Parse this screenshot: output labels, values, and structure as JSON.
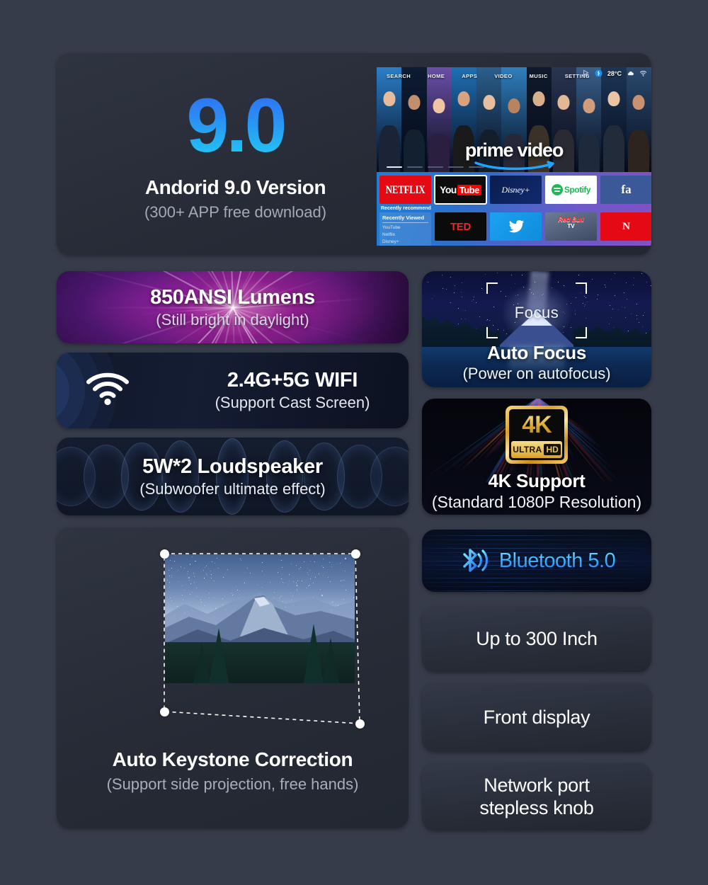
{
  "theme": {
    "page_bg": "#373c4a",
    "card_bg": "#2b303c",
    "accent_cyan": "#1fd2f5",
    "accent_blue": "#2d6bf5",
    "gold": "#d9a32c"
  },
  "android": {
    "version_number": "9.0",
    "title": "Andorid 9.0 Version",
    "subtitle": "(300+ APP free download)",
    "tv": {
      "nav_items": [
        "SEARCH",
        "HOME",
        "APPS",
        "VIDEO",
        "MUSIC",
        "SETTING"
      ],
      "status": {
        "cursor_icon": "cursor-icon",
        "bluetooth_icon": "bluetooth-icon",
        "temperature": "28°C",
        "weather_icon": "cloud-icon",
        "wifi_icon": "wifi-icon"
      },
      "brand": "prime video",
      "apps_row1": [
        "NETFLIX",
        "YouTube",
        "Disney+",
        "Spotify",
        "facebook"
      ],
      "apps_row2": [
        "TED",
        "Twitter",
        "Red Bull TV",
        "Netflix"
      ],
      "youtube_y": "You",
      "youtube_t": "Tube",
      "netflix": "NETFLIX",
      "disney": "Disney+",
      "spotify": "Spotify",
      "facebook": "fa",
      "ted": "TED",
      "redbull_top": "Red Bull",
      "redbull_bottom": "TV",
      "netflix_short": "N",
      "recently_recommend": "Recently recommend",
      "recently_viewed": "Recently Viewed",
      "recent_list": [
        "YouTube",
        "Netflix",
        "Disney+"
      ]
    }
  },
  "ansi": {
    "title": "850ANSI Lumens",
    "subtitle": "(Still bright in daylight)"
  },
  "wifi": {
    "title": "2.4G+5G WIFI",
    "subtitle": "(Support Cast Screen)",
    "icon": "wifi-icon"
  },
  "speaker": {
    "title": "5W*2 Loudspeaker",
    "subtitle": "(Subwoofer ultimate effect)"
  },
  "keystone": {
    "title": "Auto Keystone Correction",
    "subtitle": "(Support side projection, free hands)"
  },
  "focus": {
    "overlay_label": "Focus",
    "title": "Auto Focus",
    "subtitle": "(Power on autofocus)"
  },
  "fourk": {
    "badge_main": "4K",
    "badge_ultra": "ULTRA",
    "badge_hd": "HD",
    "title": "4K Support",
    "subtitle": "(Standard 1080P Resolution)"
  },
  "bluetooth": {
    "icon": "bluetooth-icon",
    "label": "Bluetooth 5.0"
  },
  "simple_features": [
    {
      "label": "Up to 300 Inch"
    },
    {
      "label": "Front display"
    },
    {
      "label": "Network port\nstepless knob"
    }
  ]
}
